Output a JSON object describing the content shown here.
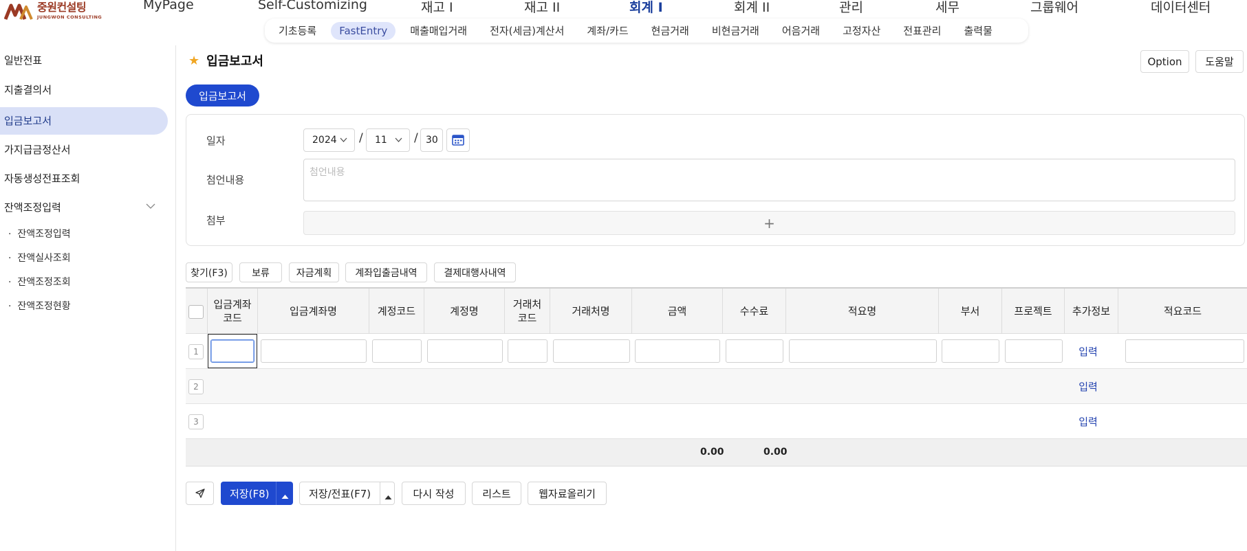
{
  "brand": {
    "name_ko": "중원컨설팅",
    "name_en": "JUNGWON CONSULTING"
  },
  "topnav": [
    {
      "label": "MyPage",
      "active": false
    },
    {
      "label": "Self-Customizing",
      "active": false
    },
    {
      "label": "재고 I",
      "active": false
    },
    {
      "label": "재고 II",
      "active": false
    },
    {
      "label": "회계 I",
      "active": true
    },
    {
      "label": "회계 II",
      "active": false
    },
    {
      "label": "관리",
      "active": false
    },
    {
      "label": "세무",
      "active": false
    },
    {
      "label": "그룹웨어",
      "active": false
    },
    {
      "label": "데이터센터",
      "active": false
    }
  ],
  "subnav": [
    {
      "label": "기초등록",
      "active": false
    },
    {
      "label": "FastEntry",
      "active": true
    },
    {
      "label": "매출매입거래",
      "active": false
    },
    {
      "label": "전자(세금)계산서",
      "active": false
    },
    {
      "label": "계좌/카드",
      "active": false
    },
    {
      "label": "현금거래",
      "active": false
    },
    {
      "label": "비현금거래",
      "active": false
    },
    {
      "label": "어음거래",
      "active": false
    },
    {
      "label": "고정자산",
      "active": false
    },
    {
      "label": "전표관리",
      "active": false
    },
    {
      "label": "출력물",
      "active": false
    }
  ],
  "sidebar": {
    "items": [
      {
        "label": "일반전표"
      },
      {
        "label": "지출결의서"
      },
      {
        "label": "입금보고서"
      },
      {
        "label": "가지급금정산서"
      },
      {
        "label": "자동생성전표조회"
      },
      {
        "label": "잔액조정입력"
      }
    ],
    "active_index": 2,
    "subitems": [
      {
        "label": "잔액조정입력"
      },
      {
        "label": "잔액실사조회"
      },
      {
        "label": "잔액조정조회"
      },
      {
        "label": "잔액조정현황"
      }
    ]
  },
  "page": {
    "title": "입금보고서",
    "option_label": "Option",
    "help_label": "도움말",
    "tab_label": "입금보고서"
  },
  "form": {
    "date_label": "일자",
    "year": "2024",
    "month": "11",
    "day": "30",
    "memo_label": "첨언내용",
    "memo_placeholder": "첨언내용",
    "attach_label": "첨부",
    "attach_plus": "+"
  },
  "toolbar": {
    "find": "찾기(F3)",
    "hold": "보류",
    "fund_plan": "자금계획",
    "account_history": "계좌입출금내역",
    "payment_agent_history": "결제대행사내역"
  },
  "grid": {
    "columns": [
      "입금계좌\n코드",
      "입금계좌명",
      "계정코드",
      "계정명",
      "거래처\n코드",
      "거래처명",
      "금액",
      "수수료",
      "적요명",
      "부서",
      "프로젝트",
      "추가정보",
      "적요코드"
    ],
    "rows": [
      {
        "num": "1",
        "extra": "입력"
      },
      {
        "num": "2",
        "extra": "입력"
      },
      {
        "num": "3",
        "extra": "입력"
      }
    ],
    "total_amount": "0.00",
    "total_fee": "0.00"
  },
  "bottom": {
    "save": "저장(F8)",
    "save_slip": "저장/전표(F7)",
    "rewrite": "다시 작성",
    "list": "리스트",
    "web_upload": "웹자료올리기"
  },
  "colors": {
    "primary": "#1f49cf",
    "active_nav": "#1a3e9c",
    "sidebar_active": "#d9e0f7",
    "star": "#f0a623"
  }
}
